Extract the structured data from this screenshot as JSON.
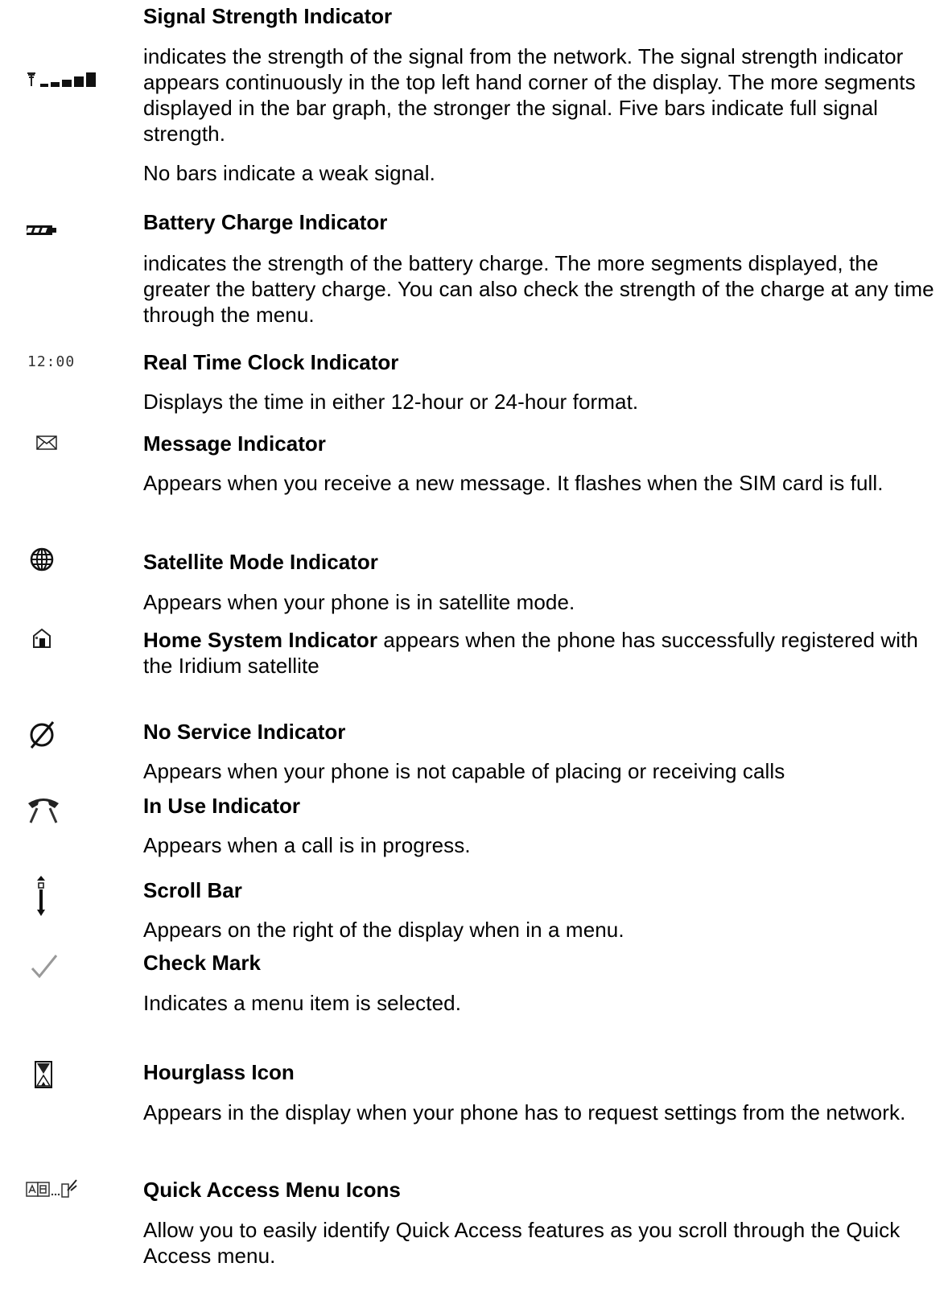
{
  "items": [
    {
      "icon": "signal-strength-icon",
      "title": "Signal Strength Indicator",
      "paragraphs": [
        "indicates the strength of the signal from the network. The signal strength indicator appears continuously in the top left hand corner of the display. The more segments displayed in the bar graph, the stronger the signal. Five bars indicate full signal strength.",
        "No bars indicate a weak signal."
      ]
    },
    {
      "icon": "battery-icon",
      "title": "Battery Charge Indicator",
      "paragraphs": [
        "indicates the strength of the battery charge. The more segments displayed, the greater the battery charge. You can also check the strength of the charge at any time through the menu."
      ]
    },
    {
      "icon": "clock-icon",
      "icon_text": "12:00",
      "title": "Real Time Clock Indicator",
      "paragraphs": [
        "Displays the time in either 12-hour or 24-hour format."
      ]
    },
    {
      "icon": "envelope-icon",
      "title": "Message Indicator",
      "paragraphs": [
        "Appears when you receive a new message. It flashes when the SIM card is full."
      ]
    },
    {
      "icon": "globe-icon",
      "title": "Satellite Mode Indicator",
      "paragraphs": [
        "Appears when your phone is in satellite mode."
      ]
    },
    {
      "icon": "home-icon",
      "title": "Home System Indicator",
      "paragraphs": [
        "appears when the phone has successfully registered with the Iridium satellite"
      ]
    },
    {
      "icon": "no-service-icon",
      "title": "No Service Indicator",
      "paragraphs": [
        "Appears when your phone is not capable of placing or receiving calls"
      ]
    },
    {
      "icon": "handset-icon",
      "title": "In Use Indicator",
      "paragraphs": [
        "Appears when a call is in progress."
      ]
    },
    {
      "icon": "scroll-bar-icon",
      "title": "Scroll Bar",
      "paragraphs": [
        "Appears on the right of the display when in a menu."
      ]
    },
    {
      "icon": "check-mark-icon",
      "title": "Check Mark",
      "paragraphs": [
        "Indicates a menu item is selected."
      ]
    },
    {
      "icon": "hourglass-icon",
      "title": "Hourglass Icon",
      "paragraphs": [
        "Appears in the display when your phone has to request settings from the network."
      ]
    },
    {
      "icon": "quick-access-icon",
      "title": "Quick Access Menu Icons",
      "paragraphs": [
        "Allow you to easily identify Quick Access features as you scroll through the Quick Access menu."
      ]
    }
  ]
}
